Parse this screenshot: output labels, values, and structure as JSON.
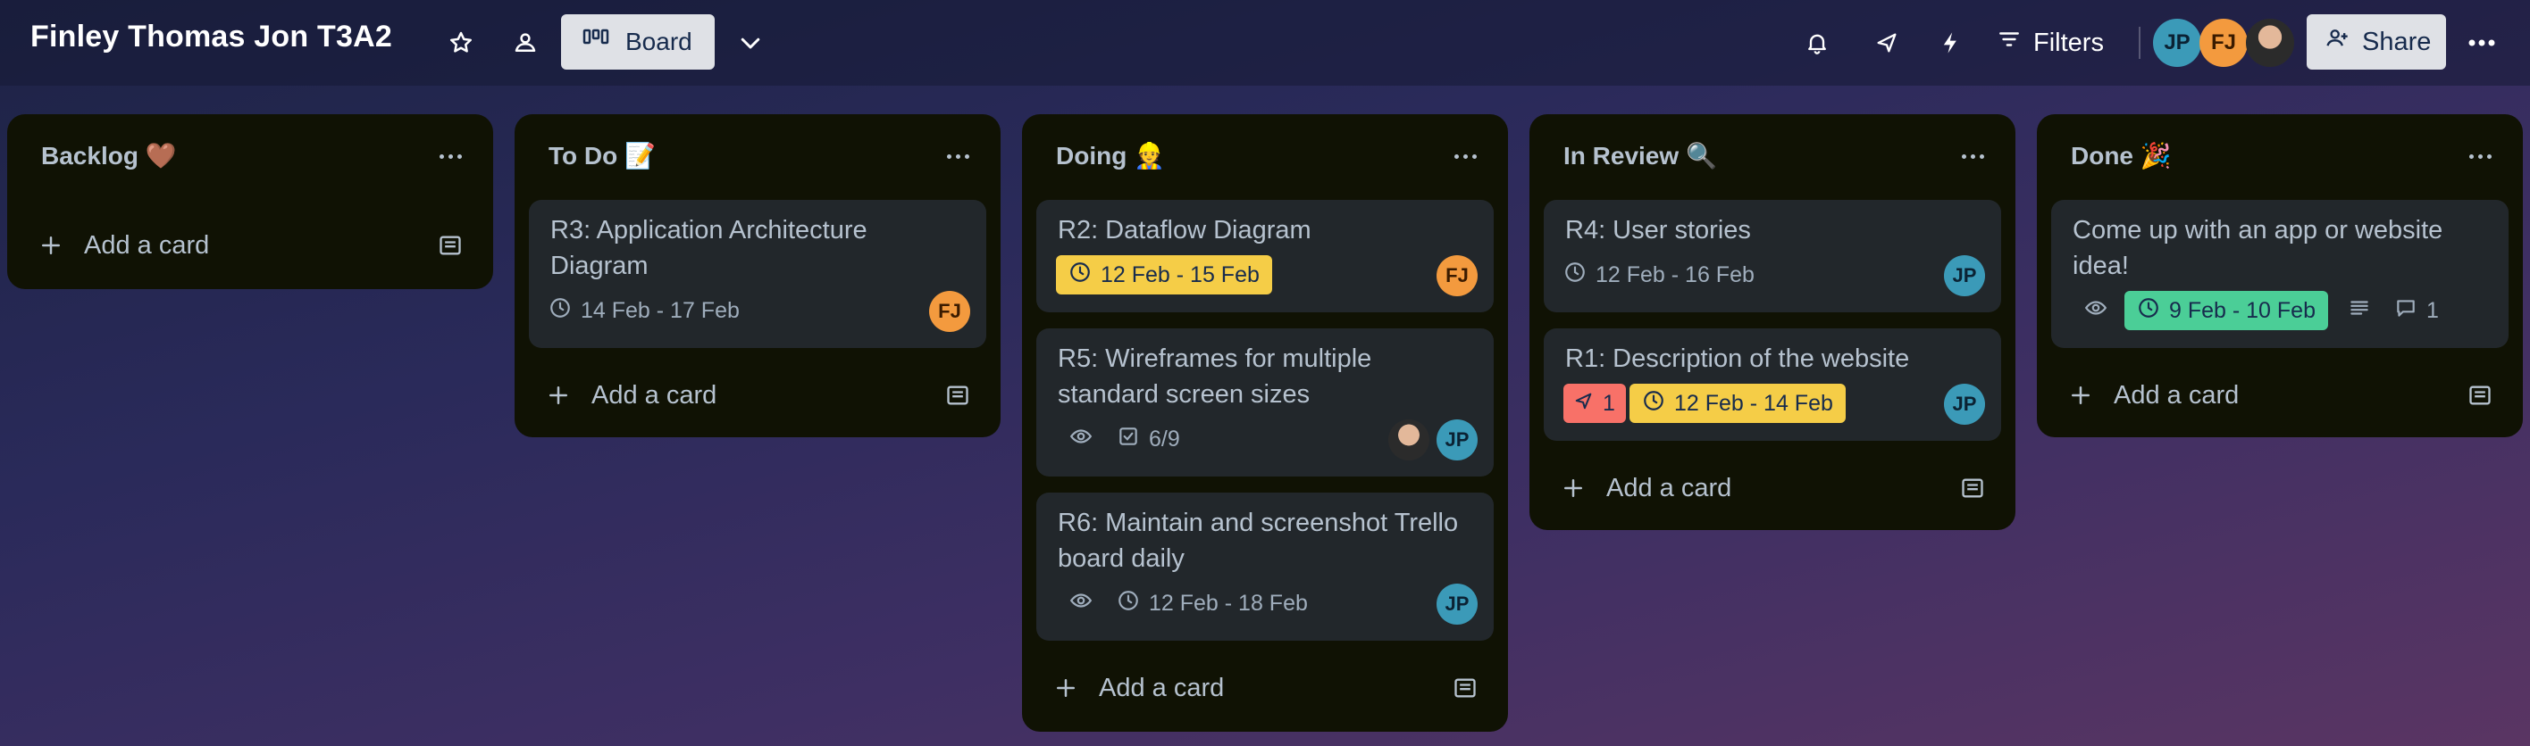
{
  "header": {
    "board_title": "Finley Thomas Jon T3A2",
    "board_view_label": "Board",
    "filters_label": "Filters",
    "share_label": "Share",
    "members": [
      "JP",
      "FJ"
    ]
  },
  "icons": {
    "star": "star-icon",
    "workspace": "workspace-icon",
    "board": "board-icon",
    "chevron": "chevron-down-icon",
    "bell": "bell-icon",
    "rocket": "power-ups-icon",
    "bolt": "automation-icon",
    "filter": "filter-icon",
    "more": "more-icon"
  },
  "colors": {
    "yellow_badge": "#f5cd47",
    "red_badge": "#f87168",
    "green_badge": "#4bce97",
    "jp_avatar": "#3b9ab8",
    "fj_avatar": "#f39a3e",
    "list_bg": "#101204",
    "card_bg": "#22272b"
  },
  "add_card_label": "Add a card",
  "lists": [
    {
      "title": "Backlog 🤎",
      "cards": []
    },
    {
      "title": "To Do 📝",
      "cards": [
        {
          "title": "R3: Application Architecture Diagram",
          "dates": "14 Feb - 17 Feb",
          "members": [
            "FJ"
          ]
        }
      ]
    },
    {
      "title": "Doing 👷",
      "cards": [
        {
          "title": "R2: Dataflow Diagram",
          "dates": "12 Feb - 15 Feb",
          "members": [
            "FJ"
          ]
        },
        {
          "title": "R5: Wireframes for multiple standard screen sizes",
          "checklist": "6/9",
          "members": [
            "photo",
            "JP"
          ]
        },
        {
          "title": "R6: Maintain and screenshot Trello board daily",
          "dates": "12 Feb - 18 Feb",
          "members": [
            "JP"
          ]
        }
      ]
    },
    {
      "title": "In Review 🔍",
      "cards": [
        {
          "title": "R4: User stories",
          "dates": "12 Feb - 16 Feb",
          "members": [
            "JP"
          ]
        },
        {
          "title": "R1: Description of the website",
          "attention": "1",
          "dates": "12 Feb - 14 Feb",
          "members": [
            "JP"
          ]
        }
      ]
    },
    {
      "title": "Done 🎉",
      "cards": [
        {
          "title": "Come up with an app or website idea!",
          "dates": "9 Feb - 10 Feb",
          "comments": "1"
        }
      ]
    }
  ]
}
